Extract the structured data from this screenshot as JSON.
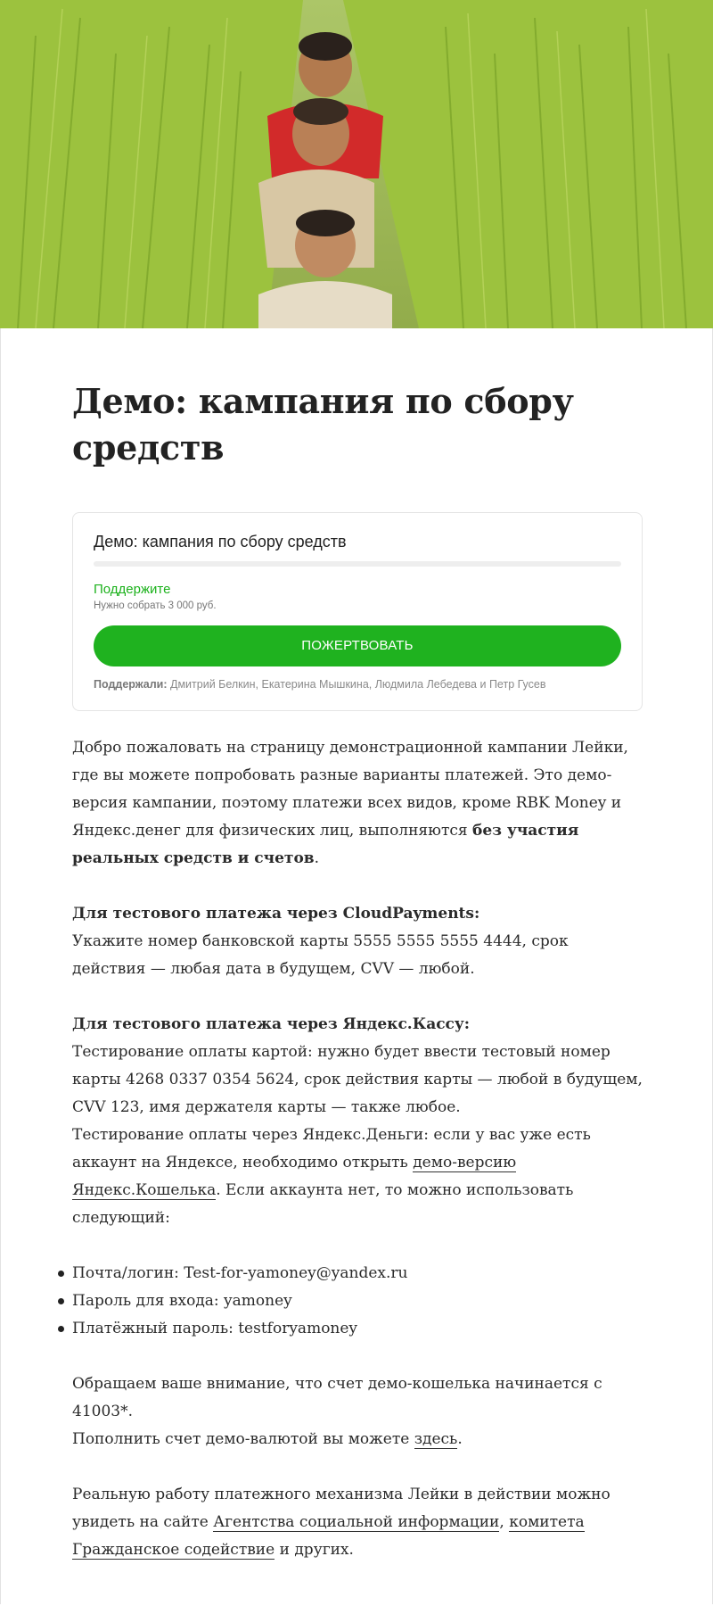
{
  "page": {
    "title": "Демо: кампания по сбору средств"
  },
  "widget": {
    "title": "Демо: кампания по сбору средств",
    "progress_fraction": 0,
    "support_label": "Поддержите",
    "goal_text": "Нужно собрать 3 000 руб.",
    "donate_label": "ПОЖЕРТВОВАТЬ",
    "backers_label": "Поддержали:",
    "backers_names": " Дмитрий Белкин, Екатерина Мышкина, Людмила Лебедева и Петр Гусев",
    "accent_color": "#1fb21f"
  },
  "article": {
    "p1_a": "Добро пожаловать на страницу демонстрационной кампании Лейки, где вы можете попробовать разные варианты платежей. Это демо-версия кампании, поэтому платежи всех видов, кроме RBK Money и Яндекс.денег для физических лиц, выполняются ",
    "p1_bold": "без участия реальных средств и счетов",
    "p1_end": ".",
    "cp_heading": "Для тестового платежа через CloudPayments:",
    "cp_text": "Укажите номер банковской карты 5555 5555 5555 4444, срок действия — любая дата в будущем, CVV — любой.",
    "yk_heading": "Для тестового платежа через Яндекс.Кассу:",
    "yk_text1": "Тестирование оплаты картой: нужно будет ввести тестовый номер карты 4268 0337 0354 5624, срок действия карты — любой в будущем, CVV 123, имя держателя карты — также любое.",
    "yk_text2_a": "Тестирование оплаты через Яндекс.Деньги: если у вас уже есть аккаунт на Яндексе, необходимо открыть ",
    "yk_link": "демо-версию Яндекс.Кошелька",
    "yk_text2_b": ". Если аккаунта нет, то можно использовать следующий:",
    "list": [
      "Почта/логин: Test-for-yamoney@yandex.ru",
      "Пароль для входа: yamoney",
      "Платёжный пароль: testforyamoney"
    ],
    "note1": "Обращаем ваше внимание, что счет демо-кошелька начинается с 41003*.",
    "note2_a": "Пополнить счет демо-валютой вы можете ",
    "note2_link": "здесь",
    "note2_b": ".",
    "final_a": "Реальную работу платежного механизма Лейки в действии можно увидеть на сайте ",
    "final_link1": "Агентства социальной информации",
    "final_sep": ", ",
    "final_link2": "комитета Гражданское содействие",
    "final_b": " и других."
  }
}
